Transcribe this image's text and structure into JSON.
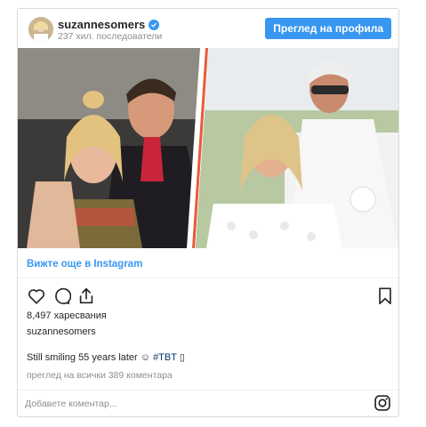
{
  "header": {
    "username": "suzannesomers",
    "followers": "237 хил. последователи",
    "view_profile_label": "Преглед на профила",
    "verified_icon": "verified-badge-icon",
    "avatar_icon": "avatar"
  },
  "photo": {
    "description_icon": "post-photo"
  },
  "links": {
    "view_more": "Вижте още в Instagram"
  },
  "actions": {
    "like_icon": "heart-icon",
    "comment_icon": "comment-icon",
    "share_icon": "share-icon",
    "save_icon": "bookmark-icon"
  },
  "post": {
    "likes": "8,497 харесвания",
    "owner": "suzannesomers",
    "caption_text": "Still smiling 55 years later ☺ ",
    "caption_tag": "#TBT",
    "caption_tail": " ▯",
    "comments_link": "преглед на всички 389 коментара"
  },
  "comment": {
    "placeholder": "Добавете коментар..."
  },
  "colors": {
    "accent": "#3897f0",
    "text": "#262626",
    "muted": "#8e8e8e",
    "border": "#dbdbdb"
  }
}
